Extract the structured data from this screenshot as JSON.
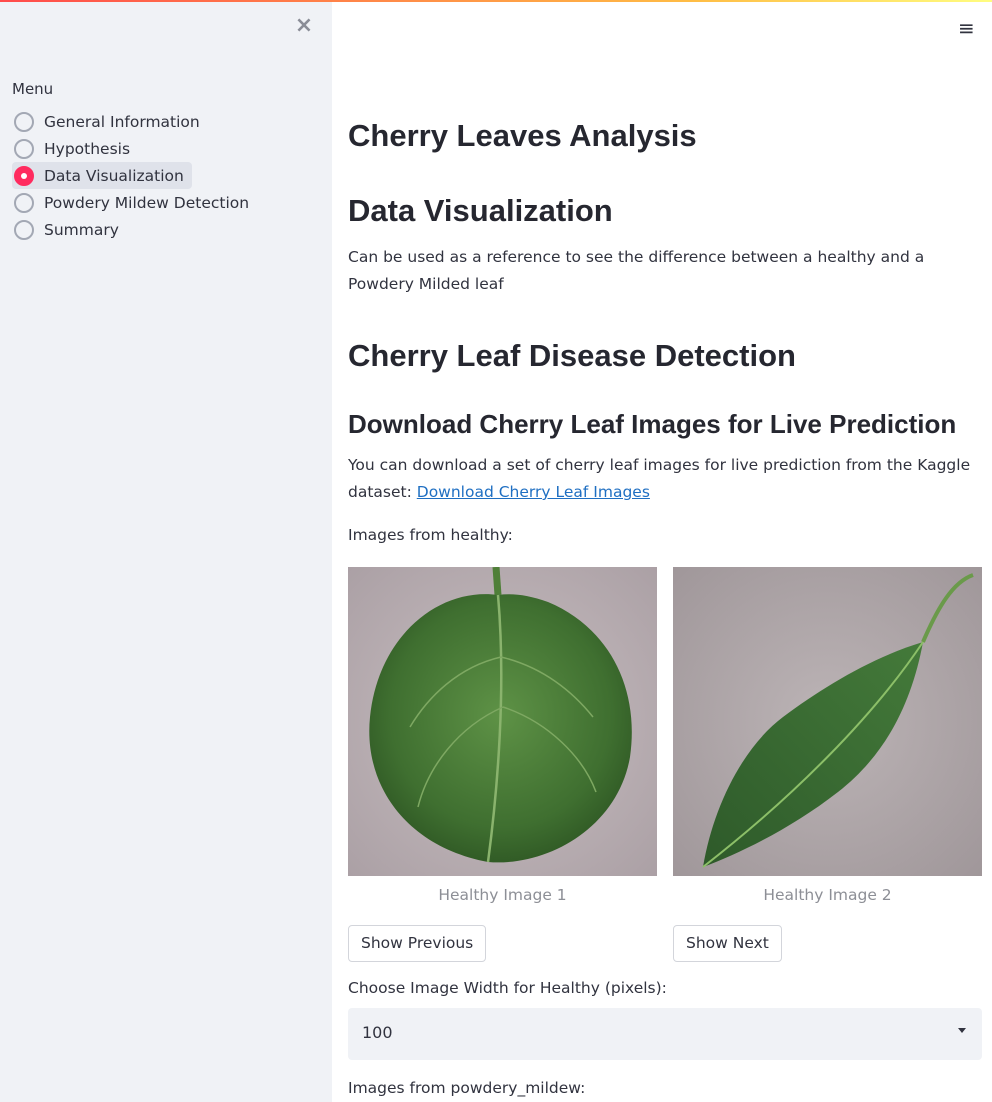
{
  "sidebar": {
    "close_icon": "×",
    "menu_label": "Menu",
    "items": [
      {
        "label": "General Information",
        "selected": false
      },
      {
        "label": "Hypothesis",
        "selected": false
      },
      {
        "label": "Data Visualization",
        "selected": true
      },
      {
        "label": "Powdery Mildew Detection",
        "selected": false
      },
      {
        "label": "Summary",
        "selected": false
      }
    ]
  },
  "header": {
    "menu_icon": "≡"
  },
  "main": {
    "title": "Cherry Leaves Analysis",
    "section_title": "Data Visualization",
    "section_description": "Can be used as a reference to see the difference between a healthy and a Powdery Milded leaf",
    "detection_title": "Cherry Leaf Disease Detection",
    "download_title": "Download Cherry Leaf Images for Live Prediction",
    "download_text": "You can download a set of cherry leaf images for live prediction from the Kaggle dataset: ",
    "download_link": "Download Cherry Leaf Images",
    "healthy_label": "Images from healthy:",
    "images": [
      {
        "caption": "Healthy Image 1"
      },
      {
        "caption": "Healthy Image 2"
      }
    ],
    "show_previous": "Show Previous",
    "show_next": "Show Next",
    "width_label": "Choose Image Width for Healthy (pixels):",
    "width_value": "100",
    "mildew_label": "Images from powdery_mildew:"
  },
  "colors": {
    "accent": "#ff2b5f",
    "sidebar_bg": "#f0f2f6",
    "link": "#1f6fc2"
  }
}
